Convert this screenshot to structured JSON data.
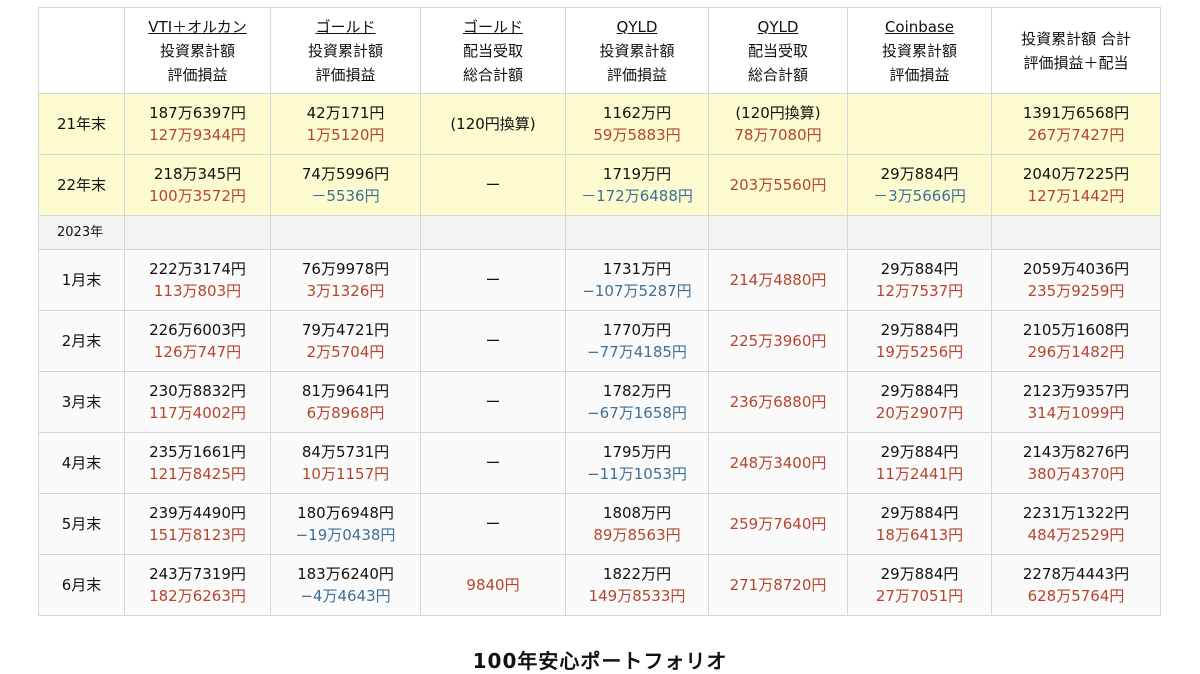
{
  "headers": [
    {
      "lines": []
    },
    {
      "lines": [
        "VTI＋オルカン",
        "投資累計額",
        "評価損益"
      ],
      "underline_first": true
    },
    {
      "lines": [
        "ゴールド",
        "投資累計額",
        "評価損益"
      ],
      "underline_first": true
    },
    {
      "lines": [
        "ゴールド",
        "配当受取",
        "総合計額"
      ],
      "underline_first": true
    },
    {
      "lines": [
        "QYLD",
        "投資累計額",
        "評価損益"
      ],
      "underline_first": true
    },
    {
      "lines": [
        "QYLD",
        "配当受取",
        "総合計額"
      ],
      "underline_first": true
    },
    {
      "lines": [
        "Coinbase",
        "投資累計額",
        "評価損益"
      ],
      "underline_first": true
    },
    {
      "lines": [
        "投資累計額 合計",
        "評価損益＋配当"
      ],
      "underline_first": false
    }
  ],
  "section_label": "2023年",
  "rows": [
    {
      "label": "21年末",
      "highlight": true,
      "cells": [
        {
          "a": "187万6397円",
          "b": "127万9344円",
          "b_color": "red"
        },
        {
          "a": "42万171円",
          "b": "1万5120円",
          "b_color": "red"
        },
        {
          "a": "(120円換算)",
          "b": "",
          "a_color": "black"
        },
        {
          "a": "1162万円",
          "b": "59万5883円",
          "b_color": "red"
        },
        {
          "a": "(120円換算)",
          "b": "78万7080円",
          "b_color": "red"
        },
        {
          "a": "",
          "b": ""
        },
        {
          "a": "1391万6568円",
          "b": "267万7427円",
          "b_color": "red"
        }
      ]
    },
    {
      "label": "22年末",
      "highlight": true,
      "cells": [
        {
          "a": "218万345円",
          "b": "100万3572円",
          "b_color": "red"
        },
        {
          "a": "74万5996円",
          "b": "－5536円",
          "b_color": "blue"
        },
        {
          "a": "ー",
          "b": "",
          "a_color": "black"
        },
        {
          "a": "1719万円",
          "b": "－172万6488円",
          "b_color": "blue"
        },
        {
          "a": "203万5560円",
          "b": "",
          "a_color": "red"
        },
        {
          "a": "29万884円",
          "b": "－3万5666円",
          "b_color": "blue"
        },
        {
          "a": "2040万7225円",
          "b": "127万1442円",
          "b_color": "red"
        }
      ]
    },
    {
      "label": "1月末",
      "cells": [
        {
          "a": "222万3174円",
          "b": "113万803円",
          "b_color": "red"
        },
        {
          "a": "76万9978円",
          "b": "3万1326円",
          "b_color": "red"
        },
        {
          "a": "ー",
          "b": "",
          "a_color": "black"
        },
        {
          "a": "1731万円",
          "b": "−107万5287円",
          "b_color": "blue"
        },
        {
          "a": "214万4880円",
          "b": "",
          "a_color": "red"
        },
        {
          "a": "29万884円",
          "b": "12万7537円",
          "b_color": "red"
        },
        {
          "a": "2059万4036円",
          "b": "235万9259円",
          "b_color": "red"
        }
      ]
    },
    {
      "label": "2月末",
      "cells": [
        {
          "a": "226万6003円",
          "b": "126万747円",
          "b_color": "red"
        },
        {
          "a": "79万4721円",
          "b": "2万5704円",
          "b_color": "red"
        },
        {
          "a": "ー",
          "b": "",
          "a_color": "black"
        },
        {
          "a": "1770万円",
          "b": "−77万4185円",
          "b_color": "blue"
        },
        {
          "a": "225万3960円",
          "b": "",
          "a_color": "red"
        },
        {
          "a": "29万884円",
          "b": "19万5256円",
          "b_color": "red"
        },
        {
          "a": "2105万1608円",
          "b": "296万1482円",
          "b_color": "red"
        }
      ]
    },
    {
      "label": "3月末",
      "cells": [
        {
          "a": "230万8832円",
          "b": "117万4002円",
          "b_color": "red"
        },
        {
          "a": "81万9641円",
          "b": "6万8968円",
          "b_color": "red"
        },
        {
          "a": "ー",
          "b": "",
          "a_color": "black"
        },
        {
          "a": "1782万円",
          "b": "−67万1658円",
          "b_color": "blue"
        },
        {
          "a": "236万6880円",
          "b": "",
          "a_color": "red"
        },
        {
          "a": "29万884円",
          "b": "20万2907円",
          "b_color": "red"
        },
        {
          "a": "2123万9357円",
          "b": "314万1099円",
          "b_color": "red"
        }
      ]
    },
    {
      "label": "4月末",
      "cells": [
        {
          "a": "235万1661円",
          "b": "121万8425円",
          "b_color": "red"
        },
        {
          "a": "84万5731円",
          "b": "10万1157円",
          "b_color": "red"
        },
        {
          "a": "ー",
          "b": "",
          "a_color": "black"
        },
        {
          "a": "1795万円",
          "b": "−11万1053円",
          "b_color": "blue"
        },
        {
          "a": "248万3400円",
          "b": "",
          "a_color": "red"
        },
        {
          "a": "29万884円",
          "b": "11万2441円",
          "b_color": "red"
        },
        {
          "a": "2143万8276円",
          "b": "380万4370円",
          "b_color": "red"
        }
      ]
    },
    {
      "label": "5月末",
      "cells": [
        {
          "a": "239万4490円",
          "b": "151万8123円",
          "b_color": "red"
        },
        {
          "a": "180万6948円",
          "b": "−19万0438円",
          "b_color": "blue"
        },
        {
          "a": "ー",
          "b": "",
          "a_color": "black"
        },
        {
          "a": "1808万円",
          "b": "89万8563円",
          "b_color": "red"
        },
        {
          "a": "259万7640円",
          "b": "",
          "a_color": "red"
        },
        {
          "a": "29万884円",
          "b": "18万6413円",
          "b_color": "red"
        },
        {
          "a": "2231万1322円",
          "b": "484万2529円",
          "b_color": "red"
        }
      ]
    },
    {
      "label": "6月末",
      "cells": [
        {
          "a": "243万7319円",
          "b": "182万6263円",
          "b_color": "red"
        },
        {
          "a": "183万6240円",
          "b": "−4万4643円",
          "b_color": "blue"
        },
        {
          "a": "9840円",
          "b": "",
          "a_color": "red"
        },
        {
          "a": "1822万円",
          "b": "149万8533円",
          "b_color": "red"
        },
        {
          "a": "271万8720円",
          "b": "",
          "a_color": "red"
        },
        {
          "a": "29万884円",
          "b": "27万7051円",
          "b_color": "red"
        },
        {
          "a": "2278万4443円",
          "b": "628万5764円",
          "b_color": "red"
        }
      ]
    }
  ],
  "caption": "100年安心ポートフォリオ",
  "colors": {
    "positive": "#b5452f",
    "negative": "#3f6f96",
    "highlight_row": "#fcfbcf"
  }
}
